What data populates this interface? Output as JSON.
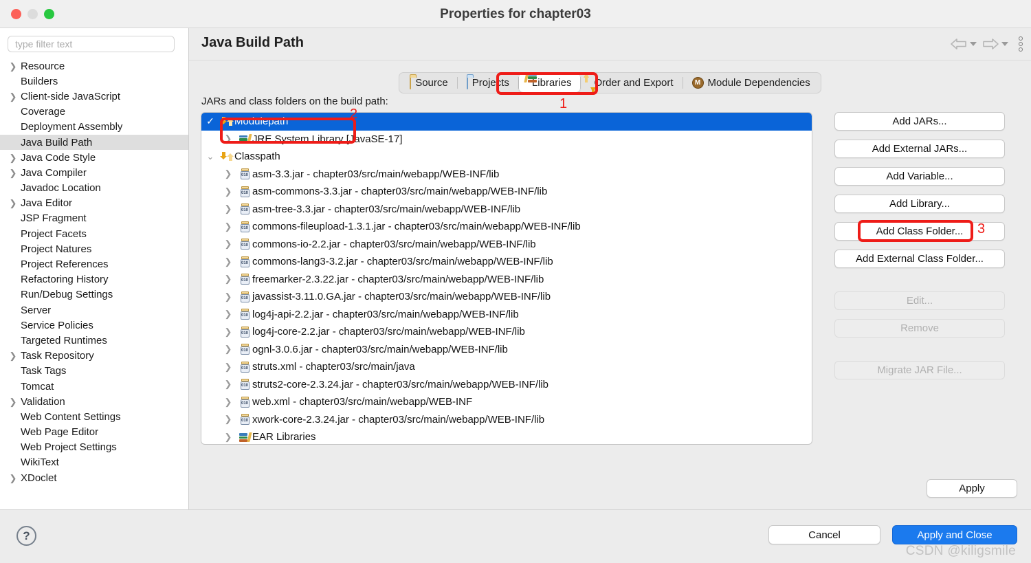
{
  "window": {
    "title": "Properties for chapter03",
    "traffic_lights": [
      "close-red",
      "minimize-gray",
      "zoom-green"
    ]
  },
  "sidebar": {
    "filter_placeholder": "type filter text",
    "filter_value": "",
    "selected": "Java Build Path",
    "items": [
      {
        "label": "Resource",
        "expandable": true
      },
      {
        "label": "Builders",
        "expandable": false
      },
      {
        "label": "Client-side JavaScript",
        "expandable": true
      },
      {
        "label": "Coverage",
        "expandable": false
      },
      {
        "label": "Deployment Assembly",
        "expandable": false
      },
      {
        "label": "Java Build Path",
        "expandable": false,
        "selected": true
      },
      {
        "label": "Java Code Style",
        "expandable": true
      },
      {
        "label": "Java Compiler",
        "expandable": true
      },
      {
        "label": "Javadoc Location",
        "expandable": false
      },
      {
        "label": "Java Editor",
        "expandable": true
      },
      {
        "label": "JSP Fragment",
        "expandable": false
      },
      {
        "label": "Project Facets",
        "expandable": false
      },
      {
        "label": "Project Natures",
        "expandable": false
      },
      {
        "label": "Project References",
        "expandable": false
      },
      {
        "label": "Refactoring History",
        "expandable": false
      },
      {
        "label": "Run/Debug Settings",
        "expandable": false
      },
      {
        "label": "Server",
        "expandable": false
      },
      {
        "label": "Service Policies",
        "expandable": false
      },
      {
        "label": "Targeted Runtimes",
        "expandable": false
      },
      {
        "label": "Task Repository",
        "expandable": true
      },
      {
        "label": "Task Tags",
        "expandable": false
      },
      {
        "label": "Tomcat",
        "expandable": false
      },
      {
        "label": "Validation",
        "expandable": true
      },
      {
        "label": "Web Content Settings",
        "expandable": false
      },
      {
        "label": "Web Page Editor",
        "expandable": false
      },
      {
        "label": "Web Project Settings",
        "expandable": false
      },
      {
        "label": "WikiText",
        "expandable": false
      },
      {
        "label": "XDoclet",
        "expandable": true
      }
    ]
  },
  "page": {
    "title": "Java Build Path",
    "nav": {
      "back": "back-arrow",
      "forward": "forward-arrow",
      "menu": "kebab-menu"
    }
  },
  "tabs": [
    {
      "label": "Source",
      "icon": "source-folder-icon",
      "active": false
    },
    {
      "label": "Projects",
      "icon": "projects-folder-icon",
      "active": false
    },
    {
      "label": "Libraries",
      "icon": "libraries-books-icon",
      "active": true
    },
    {
      "label": "Order and Export",
      "icon": "order-export-arrows-icon",
      "active": false
    },
    {
      "label": "Module Dependencies",
      "icon": "module-badge-icon",
      "active": false
    }
  ],
  "content": {
    "label": "JARs and class folders on the build path:",
    "tree": [
      {
        "label": "Modulepath",
        "icon": "path-arrows-icon",
        "level": 0,
        "state": "expanded-check",
        "selected": true
      },
      {
        "label": "JRE System Library [JavaSE-17]",
        "icon": "libraries-books-icon",
        "level": 1,
        "state": "collapsed",
        "selected": false
      },
      {
        "label": "Classpath",
        "icon": "path-arrows-icon",
        "level": 0,
        "state": "expanded",
        "selected": false
      },
      {
        "label": "asm-3.3.jar - chapter03/src/main/webapp/WEB-INF/lib",
        "icon": "jar-icon",
        "level": 1,
        "state": "collapsed",
        "selected": false
      },
      {
        "label": "asm-commons-3.3.jar - chapter03/src/main/webapp/WEB-INF/lib",
        "icon": "jar-icon",
        "level": 1,
        "state": "collapsed",
        "selected": false
      },
      {
        "label": "asm-tree-3.3.jar - chapter03/src/main/webapp/WEB-INF/lib",
        "icon": "jar-icon",
        "level": 1,
        "state": "collapsed",
        "selected": false
      },
      {
        "label": "commons-fileupload-1.3.1.jar - chapter03/src/main/webapp/WEB-INF/lib",
        "icon": "jar-icon",
        "level": 1,
        "state": "collapsed",
        "selected": false
      },
      {
        "label": "commons-io-2.2.jar - chapter03/src/main/webapp/WEB-INF/lib",
        "icon": "jar-icon",
        "level": 1,
        "state": "collapsed",
        "selected": false
      },
      {
        "label": "commons-lang3-3.2.jar - chapter03/src/main/webapp/WEB-INF/lib",
        "icon": "jar-icon",
        "level": 1,
        "state": "collapsed",
        "selected": false
      },
      {
        "label": "freemarker-2.3.22.jar - chapter03/src/main/webapp/WEB-INF/lib",
        "icon": "jar-icon",
        "level": 1,
        "state": "collapsed",
        "selected": false
      },
      {
        "label": "javassist-3.11.0.GA.jar - chapter03/src/main/webapp/WEB-INF/lib",
        "icon": "jar-icon",
        "level": 1,
        "state": "collapsed",
        "selected": false
      },
      {
        "label": "log4j-api-2.2.jar - chapter03/src/main/webapp/WEB-INF/lib",
        "icon": "jar-icon",
        "level": 1,
        "state": "collapsed",
        "selected": false
      },
      {
        "label": "log4j-core-2.2.jar - chapter03/src/main/webapp/WEB-INF/lib",
        "icon": "jar-icon",
        "level": 1,
        "state": "collapsed",
        "selected": false
      },
      {
        "label": "ognl-3.0.6.jar - chapter03/src/main/webapp/WEB-INF/lib",
        "icon": "jar-icon",
        "level": 1,
        "state": "collapsed",
        "selected": false
      },
      {
        "label": "struts.xml - chapter03/src/main/java",
        "icon": "jar-icon",
        "level": 1,
        "state": "collapsed",
        "selected": false
      },
      {
        "label": "struts2-core-2.3.24.jar - chapter03/src/main/webapp/WEB-INF/lib",
        "icon": "jar-icon",
        "level": 1,
        "state": "collapsed",
        "selected": false
      },
      {
        "label": "web.xml - chapter03/src/main/webapp/WEB-INF",
        "icon": "jar-icon",
        "level": 1,
        "state": "collapsed",
        "selected": false
      },
      {
        "label": "xwork-core-2.3.24.jar - chapter03/src/main/webapp/WEB-INF/lib",
        "icon": "jar-icon",
        "level": 1,
        "state": "collapsed",
        "selected": false
      },
      {
        "label": "EAR Libraries",
        "icon": "libraries-books-icon",
        "level": 1,
        "state": "collapsed",
        "selected": false
      }
    ]
  },
  "buttons": {
    "add_jars": "Add JARs...",
    "add_external_jars": "Add External JARs...",
    "add_variable": "Add Variable...",
    "add_library": "Add Library...",
    "add_class_folder": "Add Class Folder...",
    "add_external_class_folder": "Add External Class Folder...",
    "edit": "Edit...",
    "remove": "Remove",
    "migrate_jar_file": "Migrate JAR File...",
    "apply": "Apply"
  },
  "footer": {
    "help": "?",
    "cancel": "Cancel",
    "apply_and_close": "Apply and Close",
    "watermark": "CSDN @kiligsmile"
  },
  "annotations": [
    {
      "number": "1",
      "target": "Libraries tab"
    },
    {
      "number": "2",
      "target": "Modulepath row"
    },
    {
      "number": "3",
      "target": "Add Library... button"
    }
  ],
  "colors": {
    "selection_blue": "#0a64d8",
    "primary_button": "#1b7aee",
    "annotation_red": "#ee1c18"
  }
}
